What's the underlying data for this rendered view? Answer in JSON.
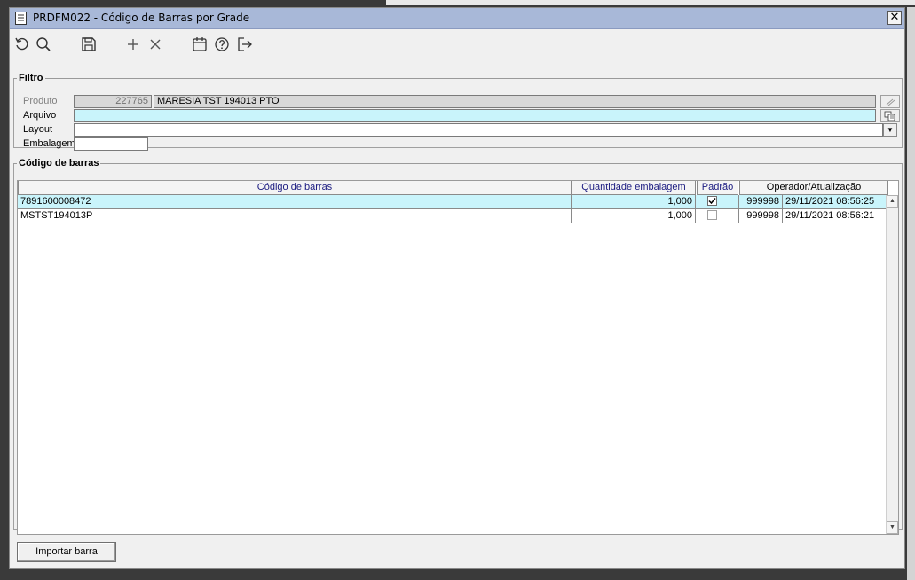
{
  "window": {
    "title": "PRDFM022 - Código de Barras por Grade",
    "close_label": "✕"
  },
  "toolbar": {
    "icons": [
      "refresh-icon",
      "search-icon",
      "save-icon",
      "add-icon",
      "delete-icon",
      "calendar-icon",
      "help-icon",
      "exit-icon"
    ]
  },
  "filtro": {
    "legend": "Filtro",
    "produto_label": "Produto",
    "produto_code": "227765",
    "produto_desc": "MARESIA TST 194013 PTO",
    "arquivo_label": "Arquivo",
    "arquivo_value": "",
    "layout_label": "Layout",
    "layout_value": "",
    "embalagem_label": "Embalagem",
    "embalagem_value": ""
  },
  "barras": {
    "legend": "Código de barras",
    "columns": {
      "codigo": "Código de barras",
      "quantidade": "Quantidade embalagem",
      "padrao": "Padrão",
      "operador": "Operador/Atualização"
    },
    "rows": [
      {
        "codigo": "7891600008472",
        "quantidade": "1,000",
        "padrao": true,
        "operador": "999998",
        "atualizacao": "29/11/2021 08:56:25"
      },
      {
        "codigo": "MSTST194013P",
        "quantidade": "1,000",
        "padrao": false,
        "operador": "999998",
        "atualizacao": "29/11/2021 08:56:21"
      }
    ]
  },
  "buttons": {
    "importar": "Importar barra"
  },
  "colors": {
    "titlebar": "#a8b8d8",
    "selected_row": "#c9f4fb",
    "header_text": "#1a1a80"
  }
}
